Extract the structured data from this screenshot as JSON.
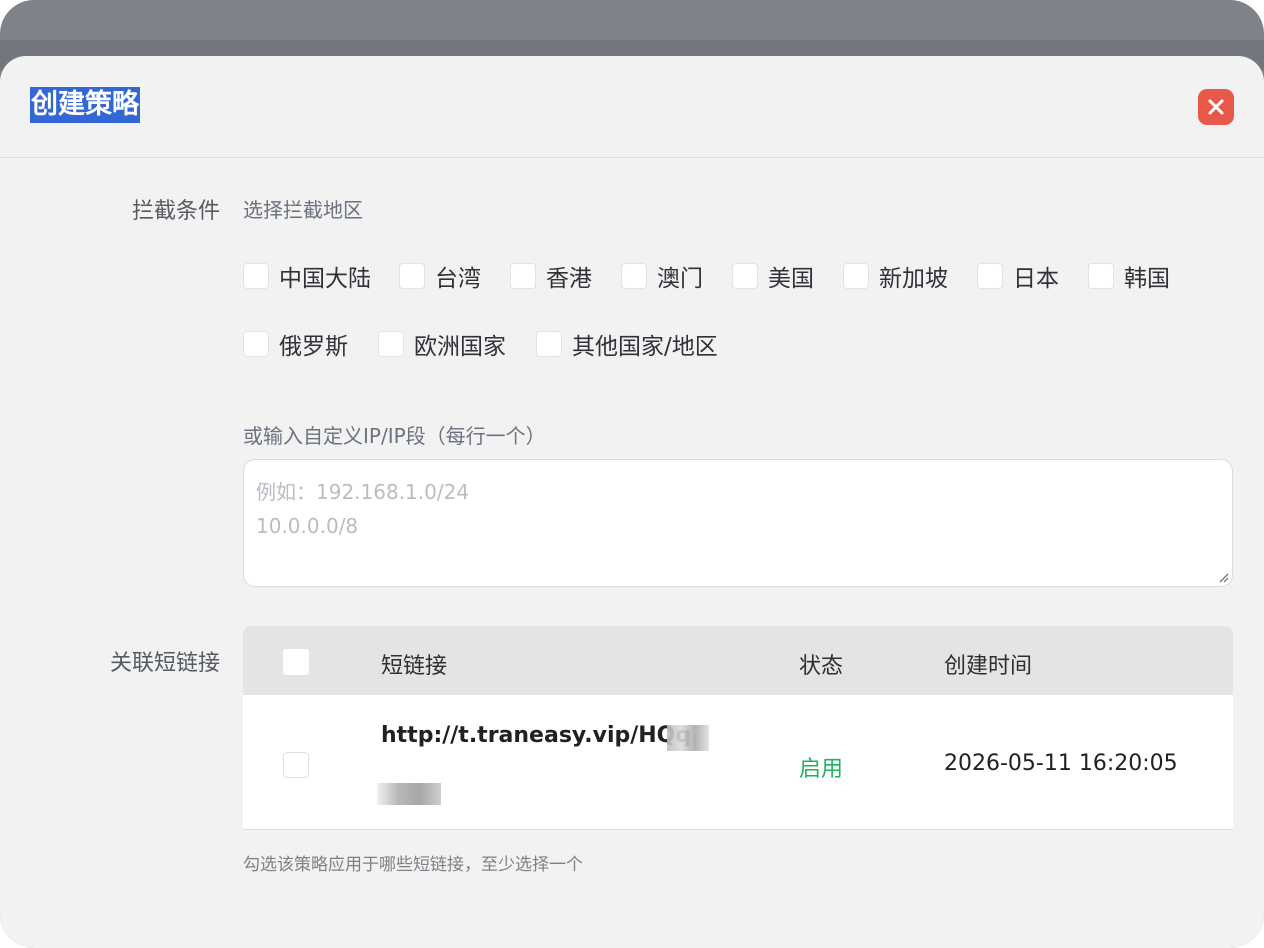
{
  "dialog": {
    "title": "创建策略",
    "close_icon": "close-icon",
    "accent_close": "#e8594a"
  },
  "block_condition": {
    "label": "拦截条件",
    "hint": "选择拦截地区",
    "regions_row1": [
      "中国大陆",
      "台湾",
      "香港",
      "澳门",
      "美国",
      "新加坡",
      "日本",
      "韩国"
    ],
    "regions_row2": [
      "俄罗斯",
      "欧洲国家",
      "其他国家/地区"
    ],
    "custom_ip_label": "或输入自定义IP/IP段（每行一个）",
    "custom_ip_placeholder_line1": "例如：192.168.1.0/24",
    "custom_ip_placeholder_line2": "10.0.0.0/8"
  },
  "links": {
    "label": "关联短链接",
    "columns": [
      "短链接",
      "状态",
      "创建时间"
    ],
    "rows": [
      {
        "url": "http://t.traneasy.vip/HQq",
        "status": "启用",
        "created": "2026-05-11 16:20:05"
      }
    ],
    "footnote": "勾选该策略应用于哪些短链接，至少选择一个",
    "status_color": "#22b35e"
  }
}
